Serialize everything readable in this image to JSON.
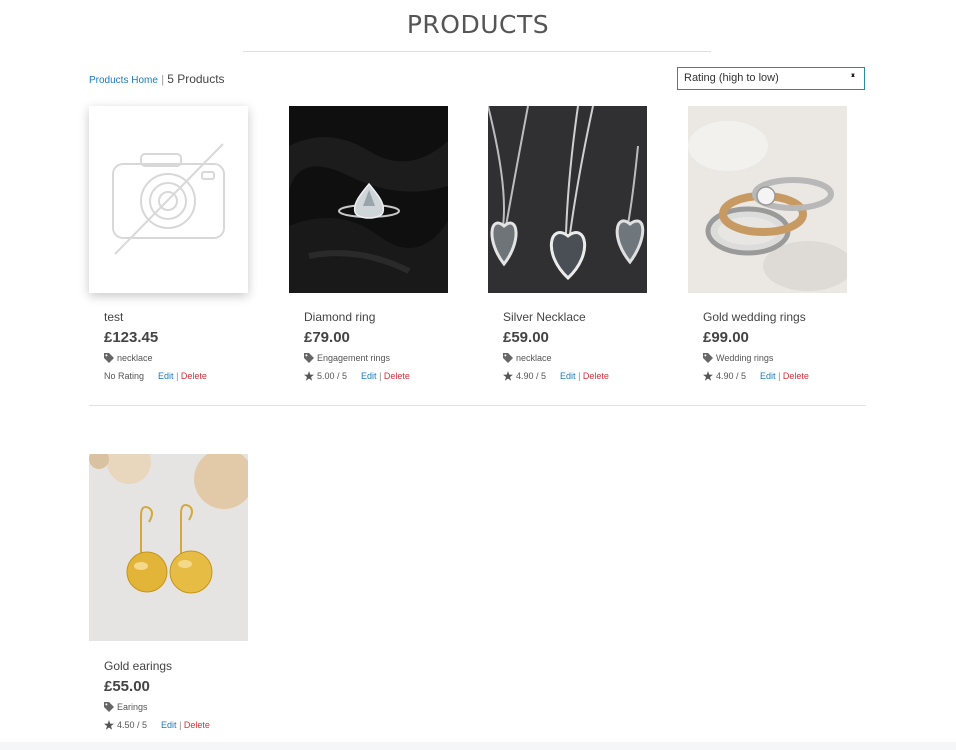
{
  "header": {
    "title": "PRODUCTS"
  },
  "breadcrumb": {
    "home_label": "Products Home",
    "separator": "|",
    "count_label": "5 Products"
  },
  "sort": {
    "selected": "Rating (high to low)"
  },
  "products": [
    {
      "name": "test",
      "price": "£123.45",
      "category": "necklace",
      "rating": "No Rating",
      "edit": "Edit",
      "sep": "|",
      "delete": "Delete"
    },
    {
      "name": "Diamond ring",
      "price": "£79.00",
      "category": "Engagement rings",
      "rating": "5.00 / 5",
      "edit": "Edit",
      "sep": "|",
      "delete": "Delete"
    },
    {
      "name": "Silver Necklace",
      "price": "£59.00",
      "category": "necklace",
      "rating": "4.90 / 5",
      "edit": "Edit",
      "sep": "|",
      "delete": "Delete"
    },
    {
      "name": "Gold wedding rings",
      "price": "£99.00",
      "category": "Wedding rings",
      "rating": "4.90 / 5",
      "edit": "Edit",
      "sep": "|",
      "delete": "Delete"
    },
    {
      "name": "Gold earings",
      "price": "£55.00",
      "category": "Earings",
      "rating": "4.50 / 5",
      "edit": "Edit",
      "sep": "|",
      "delete": "Delete"
    }
  ],
  "icons": {
    "tag": "tag-icon",
    "star": "star-icon",
    "no_image": "camera-slash-icon"
  },
  "colors": {
    "link": "#1a7bbd",
    "delete": "#d0343b",
    "select_border": "#2b8a9e",
    "text": "#444444"
  }
}
